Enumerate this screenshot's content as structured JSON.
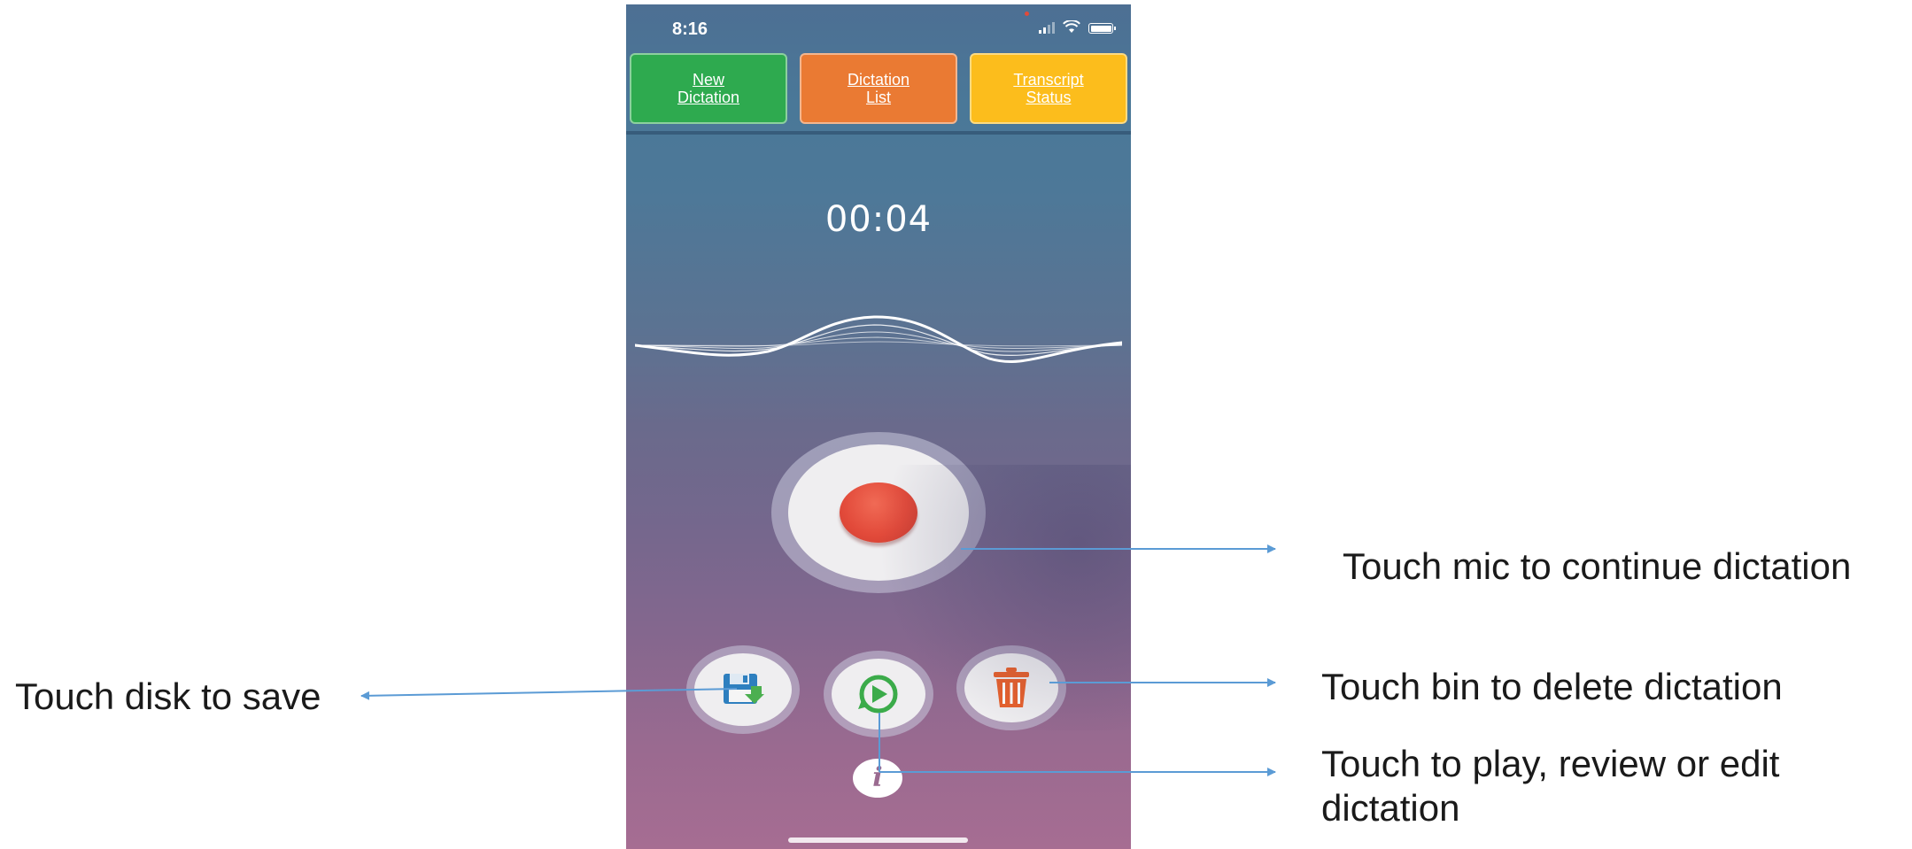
{
  "status_bar": {
    "time": "8:16"
  },
  "nav": {
    "tiles": [
      {
        "label": "New\nDictation",
        "color": "#2eaa4f"
      },
      {
        "label": "Dictation\nList",
        "color": "#ea7a33"
      },
      {
        "label": "Transcript\nStatus",
        "color": "#fcbd1c"
      }
    ]
  },
  "recorder": {
    "timer": "00:04",
    "record_icon": "record-dot-icon",
    "accent_red": "#e24a3a"
  },
  "controls": {
    "save_icon": "floppy-disk-icon",
    "play_icon": "play-review-icon",
    "delete_icon": "trash-bin-icon",
    "info_label": "i"
  },
  "annotations": {
    "save": "Touch disk to save",
    "mic": "Touch mic to continue dictation",
    "bin": "Touch bin to delete dictation",
    "play": "Touch to play, review or edit dictation"
  },
  "colors": {
    "annotation_arrow": "#5b9bd5"
  }
}
